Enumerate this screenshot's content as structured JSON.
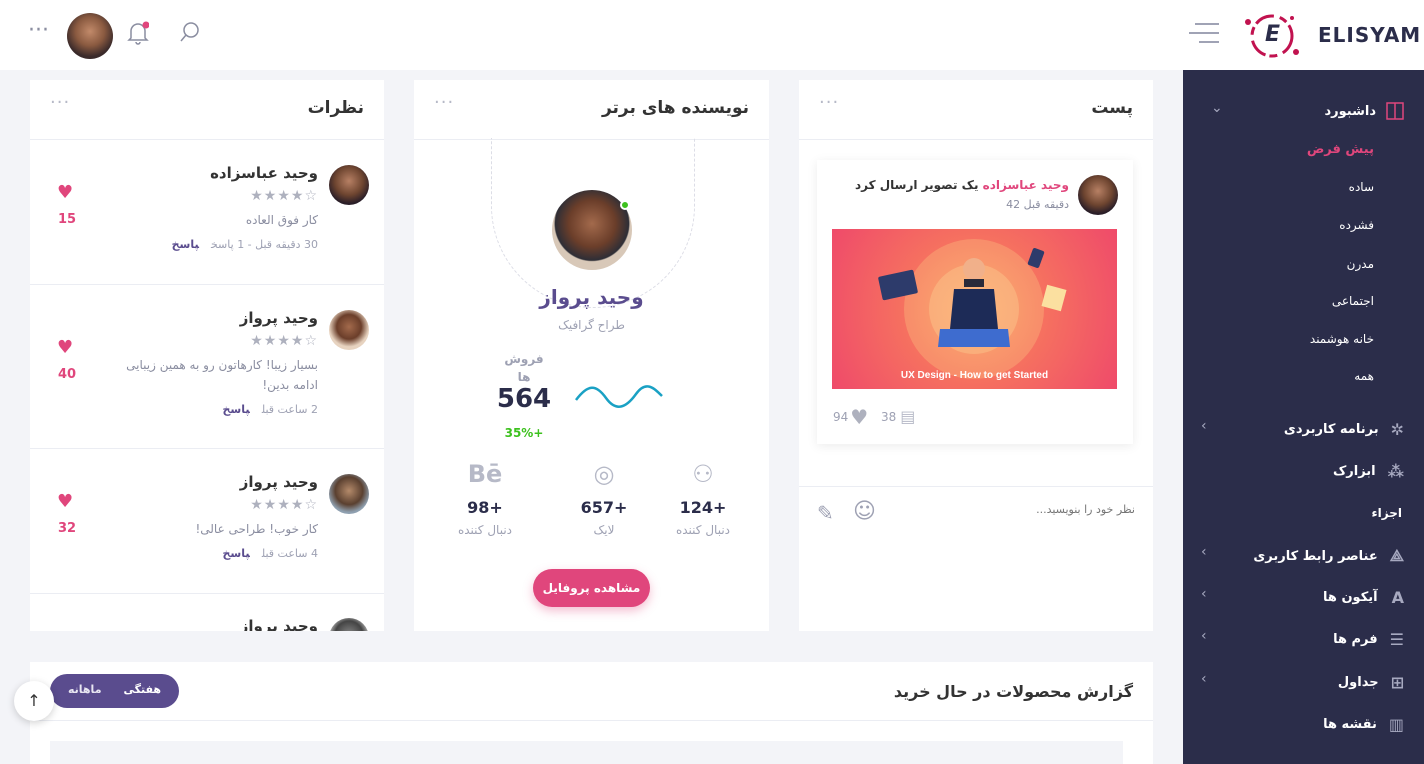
{
  "brand": {
    "name": "ELISYAM",
    "logo_letter": "E"
  },
  "topbar": {
    "dots": "···"
  },
  "sidebar": {
    "dashboard": "داشبورد",
    "sub_items": [
      "پیش فرض",
      "ساده",
      "فشرده",
      "مدرن",
      "اجتماعی",
      "خانه هوشمند",
      "همه"
    ],
    "app": "برنامه کاربردی",
    "widgets": "ابزارک",
    "section": "اجزاء",
    "ui": "عناصر رابط کاربری",
    "icons": "آیکون ها",
    "forms": "فرم ها",
    "tables": "جداول",
    "maps": "نقشه ها"
  },
  "post": {
    "title": "پست",
    "author": "وحید عباسزاده",
    "action": " یک تصویر ارسال کرد",
    "time": "42 دقیقه قبل",
    "image_caption": "UX Design - How to get Started",
    "comments": "38",
    "likes": "94",
    "placeholder": "نظر خود را بنویسید..."
  },
  "writers": {
    "title": "نویسنده های برتر",
    "name": "وحید پرواز",
    "role": "طراح گرافیک",
    "sales_label": "فروش ها",
    "sales_value": "564",
    "growth": "35%+",
    "stats": [
      {
        "value": "98+",
        "label": "دنبال کننده",
        "icon": "behance-icon",
        "glyph": "Bē"
      },
      {
        "value": "657+",
        "label": "لایک",
        "icon": "dribbble-icon",
        "glyph": "◎"
      },
      {
        "value": "124+",
        "label": "دنبال کننده",
        "icon": "users-icon",
        "glyph": "⚇"
      }
    ],
    "button": "مشاهده پروفایل"
  },
  "comments": {
    "title": "نظرات",
    "items": [
      {
        "name": "وحید عباسزاده",
        "text": "کار فوق العاده",
        "meta": "30 دقیقه قبل - 1 پاسخ",
        "reply": "پاسخ",
        "count": "15"
      },
      {
        "name": "وحید پرواز",
        "text": "بسیار زیبا! کارهاتون رو به همین زیبایی ادامه بدین!",
        "meta": "2 ساعت قبل",
        "reply": "پاسخ",
        "count": "40"
      },
      {
        "name": "وحید پرواز",
        "text": "کار خوب! طراحی عالی!",
        "meta": "4 ساعت قبل",
        "reply": "پاسخ",
        "count": "32"
      },
      {
        "name": "وحید پرواز"
      }
    ]
  },
  "report": {
    "title": "گزارش محصولات در حال خرید",
    "tab_weekly": "هفتگی",
    "tab_monthly": "ماهانه"
  },
  "colors": {
    "accent": "#e0467c",
    "sidebar": "#2b2d4a",
    "primary": "#5a4c8e"
  }
}
